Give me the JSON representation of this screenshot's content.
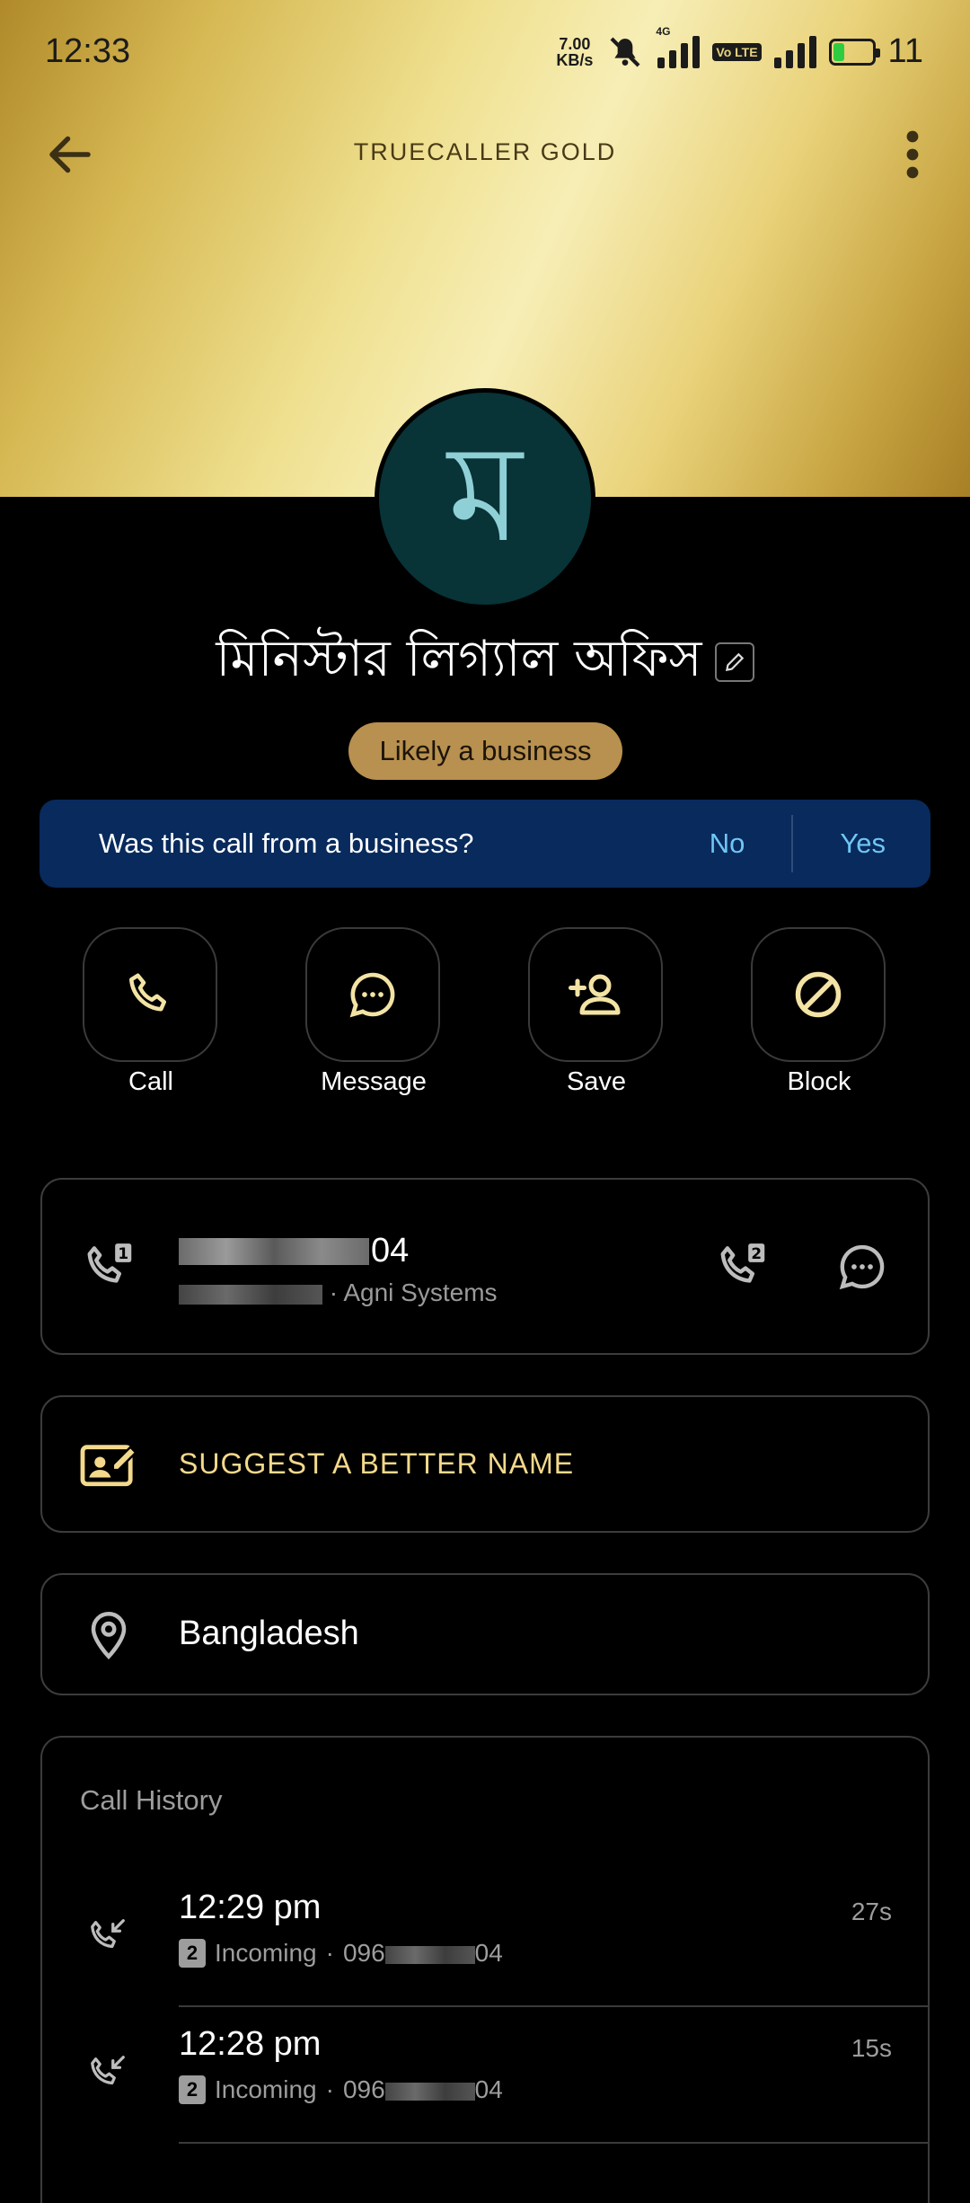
{
  "status_bar": {
    "time": "12:33",
    "net_speed_value": "7.00",
    "net_speed_unit": "KB/s",
    "network_type": "4G",
    "volte": "Vo LTE",
    "battery_level": "11"
  },
  "header": {
    "title": "TRUECALLER GOLD"
  },
  "profile": {
    "avatar_letter": "ম",
    "name": "মিনিস্টার লিগ্যাল অফিস",
    "badge": "Likely a business"
  },
  "survey": {
    "question": "Was this call from a business?",
    "no_label": "No",
    "yes_label": "Yes"
  },
  "actions": [
    {
      "label": "Call"
    },
    {
      "label": "Message"
    },
    {
      "label": "Save"
    },
    {
      "label": "Block"
    }
  ],
  "number_card": {
    "number_suffix": "04",
    "carrier": "Agni Systems",
    "separator": "·"
  },
  "suggest": {
    "label": "SUGGEST A BETTER NAME"
  },
  "location": {
    "label": "Bangladesh"
  },
  "call_history": {
    "title": "Call History",
    "entries": [
      {
        "time": "12:29 pm",
        "sim": "2",
        "type": "Incoming",
        "number_prefix": "096",
        "number_suffix": "04",
        "duration": "27s"
      },
      {
        "time": "12:28 pm",
        "sim": "2",
        "type": "Incoming",
        "number_prefix": "096",
        "number_suffix": "04",
        "duration": "15s"
      }
    ]
  },
  "colors": {
    "accent_gold": "#f3d98c",
    "survey_bg": "#082a5c",
    "survey_link": "#6fc6f4",
    "badge_bg": "#b8904f",
    "avatar_bg": "#083337"
  }
}
